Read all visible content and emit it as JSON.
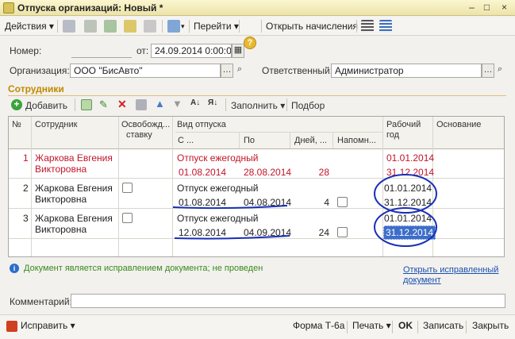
{
  "window": {
    "title": "Отпуска организаций: Новый *"
  },
  "toolbar": {
    "actions": "Действия",
    "goto": "Перейти",
    "open_accruals": "Открыть начисления"
  },
  "header": {
    "number_label": "Номер:",
    "number_value": "",
    "date_label": "от:",
    "date_value": "24.09.2014  0:00:00",
    "org_label": "Организация:",
    "org_value": "ООО \"БисАвто\"",
    "resp_label": "Ответственный:",
    "resp_value": "Администратор"
  },
  "section_title": "Сотрудники",
  "table_toolbar": {
    "add": "Добавить",
    "fill": "Заполнить",
    "select": "Подбор"
  },
  "columns": {
    "num": "№",
    "employee": "Сотрудник",
    "exempt_1": "Освобожд...",
    "exempt_2": "ставку",
    "vacation_type": "Вид отпуска",
    "from": "С ...",
    "to": "По",
    "days": "Дней, ...",
    "remind": "Напомн...",
    "work_year_1": "Рабочий",
    "work_year_2": "год",
    "basis": "Основание"
  },
  "rows": [
    {
      "n": "1",
      "name_1": "Жаркова Евгения",
      "name_2": "Викторовна",
      "type": "Отпуск ежегодный",
      "from": "01.08.2014",
      "to": "28.08.2014",
      "days": "28",
      "wy_from": "01.01.2014",
      "wy_to": "31.12.2014"
    },
    {
      "n": "2",
      "name_1": "Жаркова Евгения",
      "name_2": "Викторовна",
      "type": "Отпуск ежегодный",
      "from": "01.08.2014",
      "to": "04.08.2014",
      "days": "4",
      "wy_from": "01.01.2014",
      "wy_to": "31.12.2014"
    },
    {
      "n": "3",
      "name_1": "Жаркова Евгения",
      "name_2": "Викторовна",
      "type": "Отпуск ежегодный",
      "from": "12.08.2014",
      "to": "04.09.2014",
      "days": "24",
      "wy_from": "01.01.2014",
      "wy_to": "31.12.2014"
    }
  ],
  "info": {
    "text": "Документ является исправлением документа; не проведен",
    "link_1": "Открыть исправленный",
    "link_2": "документ"
  },
  "comment": {
    "label": "Комментарий:",
    "value": ""
  },
  "bottom": {
    "fix": "Исправить",
    "form": "Форма Т-6а",
    "print": "Печать",
    "ok": "OK",
    "save": "Записать",
    "close": "Закрыть"
  },
  "colors": {
    "section_title": "#c08a00",
    "row_red": "#c0152b",
    "selection": "#3d6dc9",
    "annotation_ink": "#1a2fb5"
  }
}
